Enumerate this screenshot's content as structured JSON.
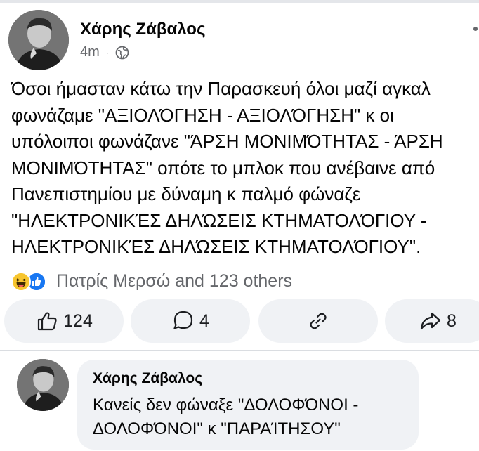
{
  "post": {
    "author": "Χάρης Ζάβαλος",
    "time": "4m",
    "separator": "·",
    "privacy_icon": "globe-icon",
    "more_icon": "more-icon",
    "lines": [
      "Όσοι ήμασταν κάτω την Παρασκευή όλοι μαζί αγκαλ",
      "φωνάζαμε \"ΑΞΙΟΛΌΓΗΣΗ - ΑΞΙΟΛΌΓΗΣΗ\" κ οι",
      "υπόλοιποι φωνάζανε \"ΆΡΣΗ ΜΟΝΙΜΌΤΗΤΑΣ - ΆΡΣΗ",
      "ΜΟΝΙΜΌΤΗΤΑΣ\" οπότε το μπλοκ που ανέβαινε από",
      "Πανεπιστημίου με δύναμη κ παλμό φώναζε",
      "\"ΗΛΕΚΤΡΟΝΙΚΈΣ ΔΗΛΏΣΕΙΣ ΚΤΗΜΑΤΟΛΌΓΙΟΥ -",
      "ΗΛΕΚΤΡΟΝΙΚΈΣ ΔΗΛΏΣΕΙΣ ΚΤΗΜΑΤΟΛΌΓΙΟΥ\"."
    ],
    "reactions": {
      "icons": [
        "haha-icon",
        "like-icon"
      ],
      "summary": "Πατρίς Μερσώ and 123 others"
    },
    "actions": {
      "like_count": "124",
      "comment_count": "4",
      "share_count": "8"
    }
  },
  "comment": {
    "author": "Χάρης Ζάβαλος",
    "lines": [
      "Κανείς δεν φώναξε \"ΔΟΛΟΦΌΝΟΙ -",
      "ΔΟΛΟΦΌΝΟΙ\" κ \"ΠΑΡΑΊΤΗΣΟΥ\""
    ]
  },
  "colors": {
    "text": "#050505",
    "secondary": "#65676b",
    "button_bg": "#f0f2f5",
    "like_blue": "#1877f2",
    "haha_yellow": "#f7c52e"
  }
}
